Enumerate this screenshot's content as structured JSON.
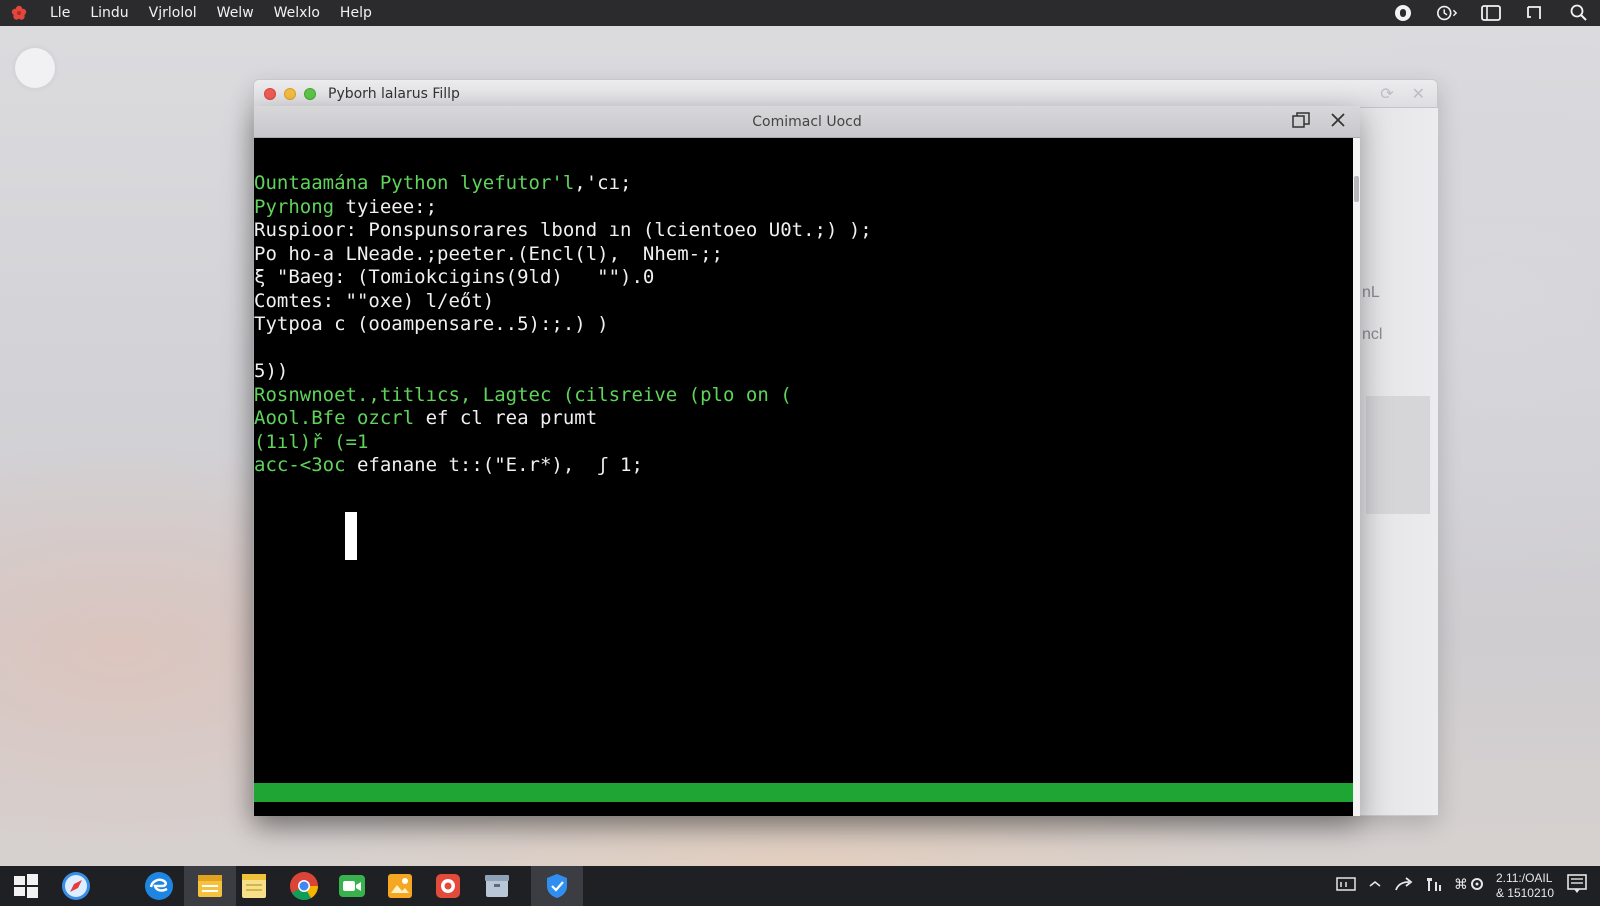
{
  "menubar": {
    "items": [
      "Lle",
      "Lindu",
      "Vjrlolol",
      "Welw",
      "Welxlo",
      "Help"
    ]
  },
  "bg_window": {
    "title": "Pyborh  lalarus  Fillp",
    "side_text_1": "nL",
    "side_text_2": "ncl"
  },
  "cmd_window": {
    "title": "Comimacl Uocd",
    "lines": [
      {
        "segments": [
          {
            "text": "Ountaamána Python lyefutor'l",
            "color": "green"
          },
          {
            "text": ",'cı;",
            "color": "white"
          }
        ]
      },
      {
        "segments": [
          {
            "text": "Pyrhong",
            "color": "green"
          },
          {
            "text": " tyieee:;",
            "color": "white"
          }
        ]
      },
      {
        "segments": [
          {
            "text": "Ruspioor: Ponspunsorares lbond ın (lcientoeo U0t.;) );",
            "color": "white"
          }
        ]
      },
      {
        "segments": [
          {
            "text": "Po ho-a LNeade.;peeter.(Encl(l),  Nhem-;;",
            "color": "white"
          }
        ]
      },
      {
        "segments": [
          {
            "text": "ξ \"Baeg: (Tomiokcigins(9ld)   \"\").0",
            "color": "white"
          }
        ]
      },
      {
        "segments": [
          {
            "text": "Comtes: \"\"oxe) l/eőt)",
            "color": "white"
          }
        ]
      },
      {
        "segments": [
          {
            "text": "Tytpoa c (ooampensare..5):;.) )",
            "color": "white"
          }
        ]
      },
      {
        "segments": [
          {
            "text": "",
            "color": "white"
          }
        ]
      },
      {
        "segments": [
          {
            "text": "5))",
            "color": "white"
          }
        ]
      },
      {
        "segments": [
          {
            "text": "Rosnwnoet.,titlıcs, Lagtec (cilsreive (plo on (",
            "color": "green"
          }
        ]
      },
      {
        "segments": [
          {
            "text": "Aool.Bfe ozcrl",
            "color": "green"
          },
          {
            "text": " ef cl rea prumt",
            "color": "white"
          }
        ]
      },
      {
        "segments": [
          {
            "text": "(1ıl)ř (=1",
            "color": "green"
          }
        ]
      },
      {
        "segments": [
          {
            "text": "acc-<3oc",
            "color": "green"
          },
          {
            "text": " efanane t::(\"E.r*),  ʃ 1;",
            "color": "white"
          }
        ]
      }
    ],
    "progress": 1.0
  },
  "taskbar": {
    "clock_line1": "2.11:/OAIL",
    "clock_line2": "& 1510210"
  },
  "colors": {
    "terminal_green": "#5fd45a",
    "progress_green": "#1fa534",
    "menubar_bg": "#2b2b2d",
    "taskbar_bg": "#1f2023"
  },
  "icons": {
    "menubar": [
      "app-flower-icon"
    ],
    "status": [
      "record-icon",
      "history-icon",
      "tablet-icon",
      "crop-icon",
      "search-icon"
    ],
    "taskbar": [
      "start-icon",
      "safari-icon",
      "edge-icon",
      "files-icon",
      "notes-icon",
      "chrome-icon",
      "facetime-icon",
      "photos-icon",
      "store-icon",
      "archive-icon",
      "shield-icon"
    ]
  }
}
